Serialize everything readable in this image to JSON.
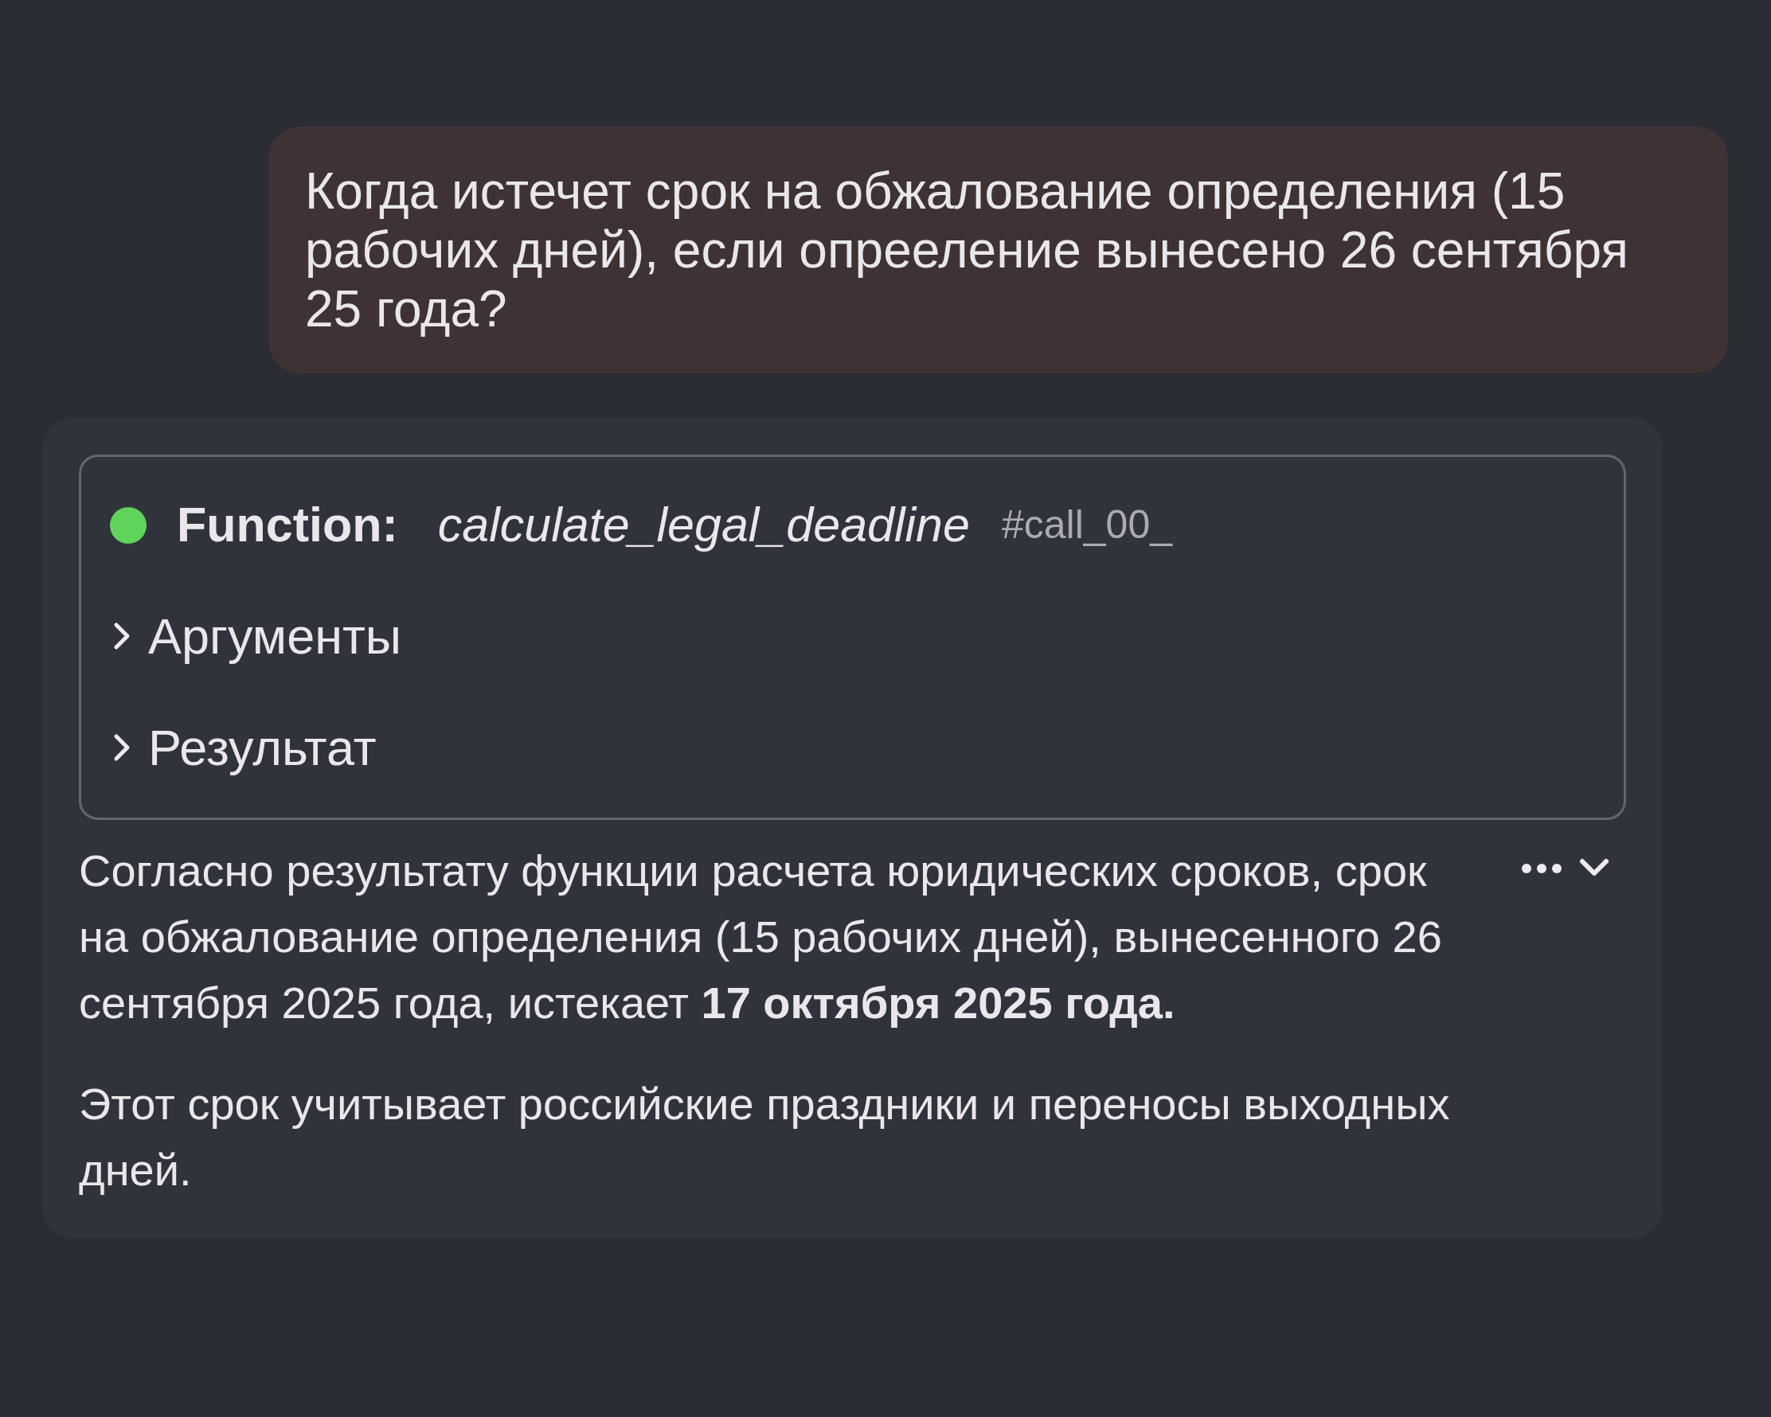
{
  "user_message": {
    "text": "Когда истечет срок на обжалование определения (15 рабочих дней), если опрееление вынесено 26 сентября 25 года?"
  },
  "assistant_message": {
    "function_call": {
      "active": true,
      "label": "Function:",
      "name": "calculate_legal_deadline",
      "call_id": "#call_00_",
      "sections": [
        {
          "label": "Аргументы",
          "expanded": false
        },
        {
          "label": "Результат",
          "expanded": false
        }
      ]
    },
    "paragraphs": [
      "Согласно результату функции расчета юридических сроков, срок на обжалование определения (15 рабочих дней), вынесенного 26 сентября 2025 года, истекает **17 октября 2025 года.**",
      "Этот срок учитывает российские праздники и переносы выходных дней."
    ]
  }
}
